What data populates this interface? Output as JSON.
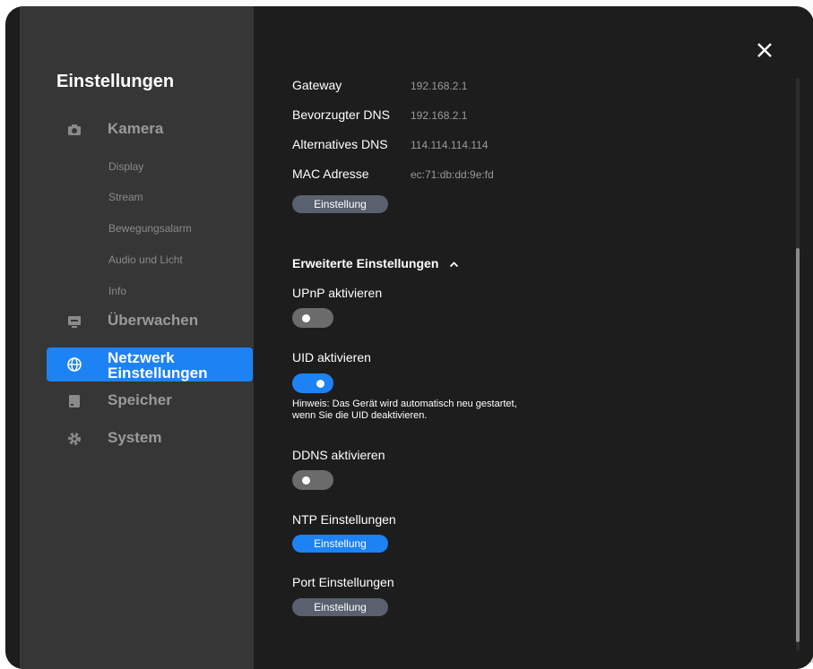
{
  "sidebar": {
    "title": "Einstellungen",
    "items": [
      {
        "label": "Kamera",
        "icon": "camera-icon"
      },
      {
        "label": "Überwachen",
        "icon": "monitor-icon"
      },
      {
        "label": "Netzwerk Einstellungen",
        "icon": "globe-icon",
        "active": true
      },
      {
        "label": "Speicher",
        "icon": "storage-icon"
      },
      {
        "label": "System",
        "icon": "gear-icon"
      }
    ],
    "sub_items": [
      "Display",
      "Stream",
      "Bewegungsalarm",
      "Audio und Licht",
      "Info"
    ]
  },
  "network": {
    "rows": [
      {
        "key": "Gateway",
        "value": "192.168.2.1"
      },
      {
        "key": "Bevorzugter DNS",
        "value": "192.168.2.1"
      },
      {
        "key": "Alternatives DNS",
        "value": "114.114.114.114"
      },
      {
        "key": "MAC Adresse",
        "value": "ec:71:db:dd:9e:fd"
      }
    ],
    "ip_button": "Einstellung"
  },
  "advanced": {
    "title": "Erweiterte Einstellungen",
    "upnp": {
      "label": "UPnP aktivieren",
      "enabled": false
    },
    "uid": {
      "label": "UID aktivieren",
      "enabled": true,
      "hint": "Hinweis: Das Gerät wird automatisch neu gestartet, wenn Sie die UID deaktivieren."
    },
    "ddns": {
      "label": "DDNS aktivieren",
      "enabled": false
    },
    "ntp": {
      "label": "NTP Einstellungen",
      "button": "Einstellung"
    },
    "port": {
      "label": "Port Einstellungen",
      "button": "Einstellung"
    }
  },
  "colors": {
    "accent": "#1d82f4",
    "panel": "#1d1d1d",
    "sidebar": "#363636"
  }
}
